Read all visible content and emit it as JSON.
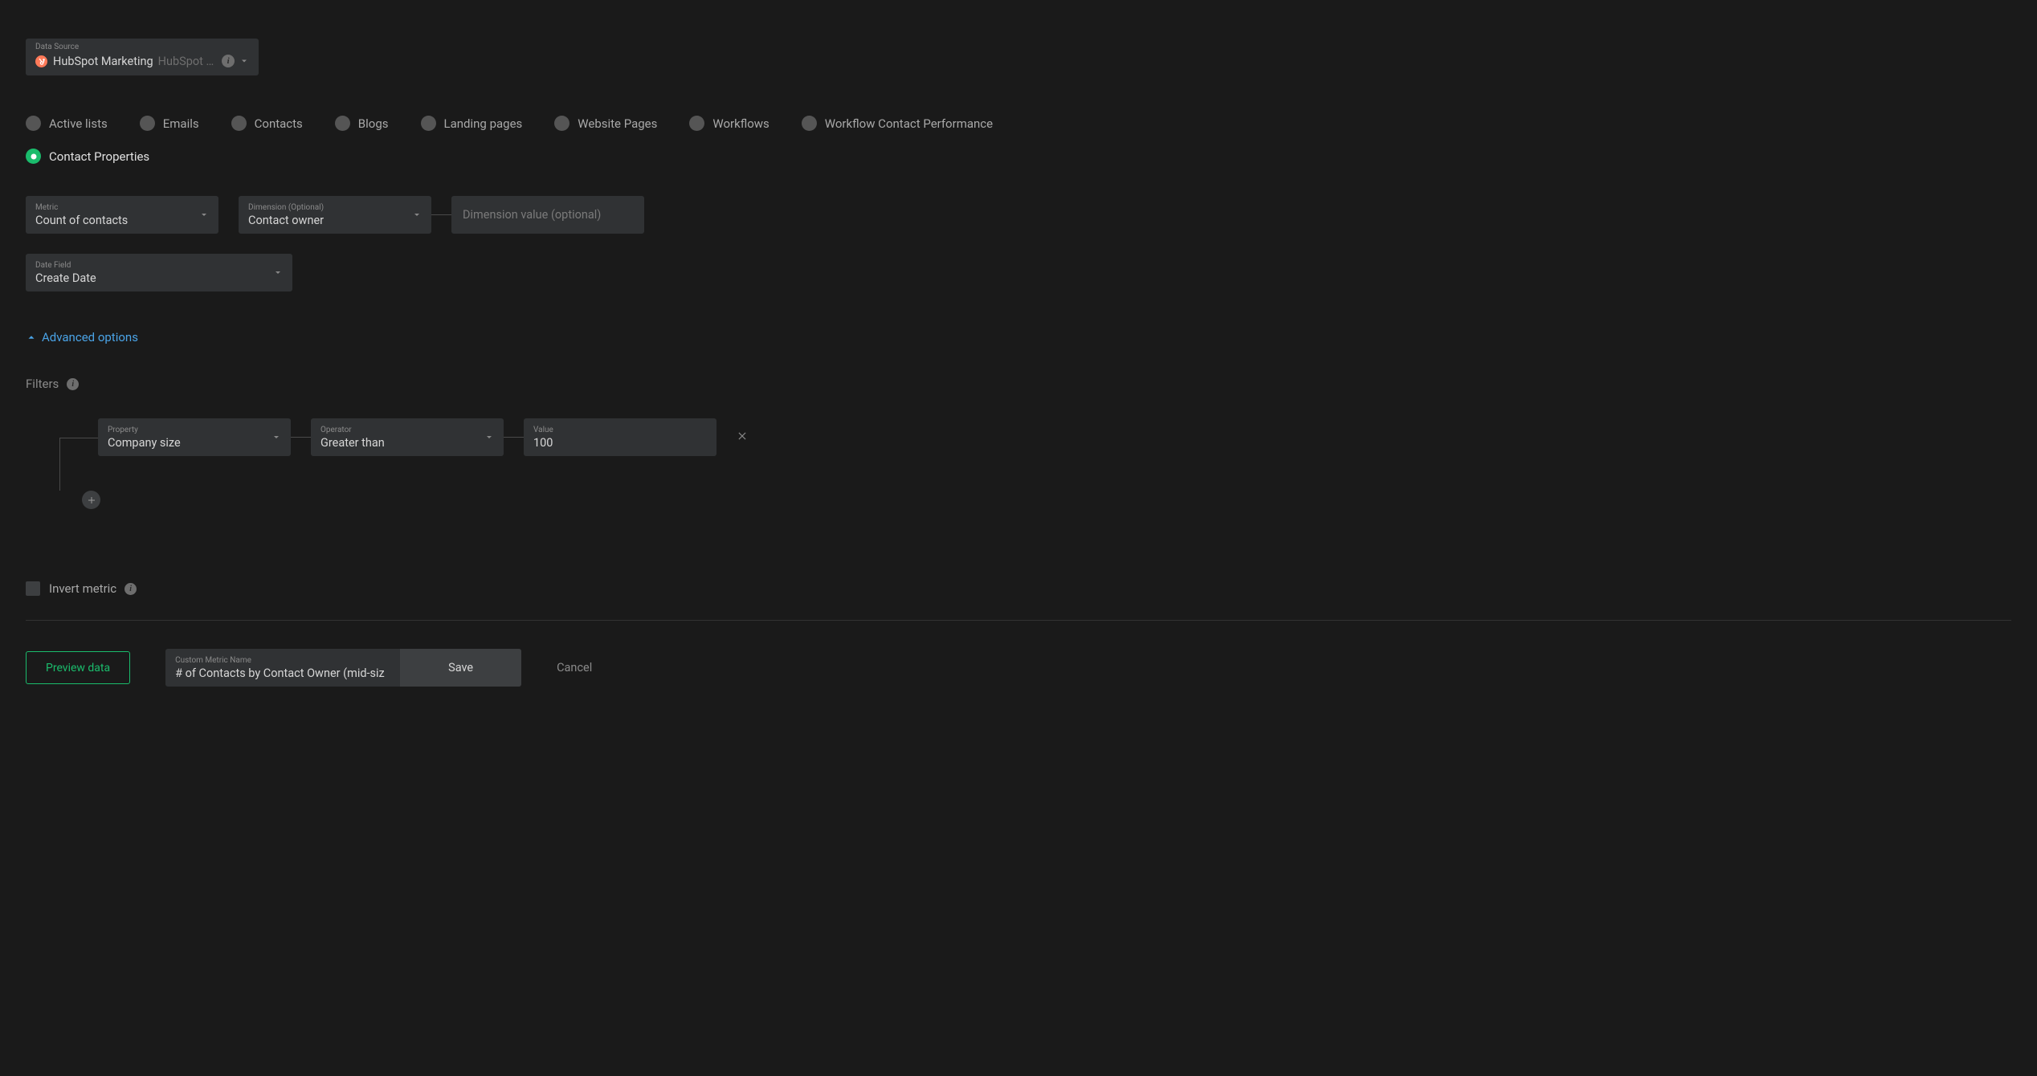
{
  "dataSource": {
    "label": "Data Source",
    "name": "HubSpot Marketing",
    "sub": "HubSpot …"
  },
  "dataTypes": [
    {
      "label": "Active lists",
      "selected": false
    },
    {
      "label": "Emails",
      "selected": false
    },
    {
      "label": "Contacts",
      "selected": false
    },
    {
      "label": "Blogs",
      "selected": false
    },
    {
      "label": "Landing pages",
      "selected": false
    },
    {
      "label": "Website Pages",
      "selected": false
    },
    {
      "label": "Workflows",
      "selected": false
    },
    {
      "label": "Workflow Contact Performance",
      "selected": false
    },
    {
      "label": "Contact Properties",
      "selected": true
    }
  ],
  "metric": {
    "label": "Metric",
    "value": "Count of contacts"
  },
  "dimension": {
    "label": "Dimension (Optional)",
    "value": "Contact owner"
  },
  "dimensionValue": {
    "placeholder": "Dimension value (optional)"
  },
  "dateField": {
    "label": "Date Field",
    "value": "Create Date"
  },
  "advancedOptions": {
    "label": "Advanced options"
  },
  "filters": {
    "header": "Filters",
    "rows": [
      {
        "propertyLabel": "Property",
        "property": "Company size",
        "operatorLabel": "Operator",
        "operator": "Greater than",
        "valueLabel": "Value",
        "value": "100"
      }
    ]
  },
  "invert": {
    "label": "Invert metric"
  },
  "footer": {
    "preview": "Preview data",
    "customLabel": "Custom Metric Name",
    "customName": "# of Contacts by Contact Owner (mid-siz",
    "save": "Save",
    "cancel": "Cancel"
  }
}
